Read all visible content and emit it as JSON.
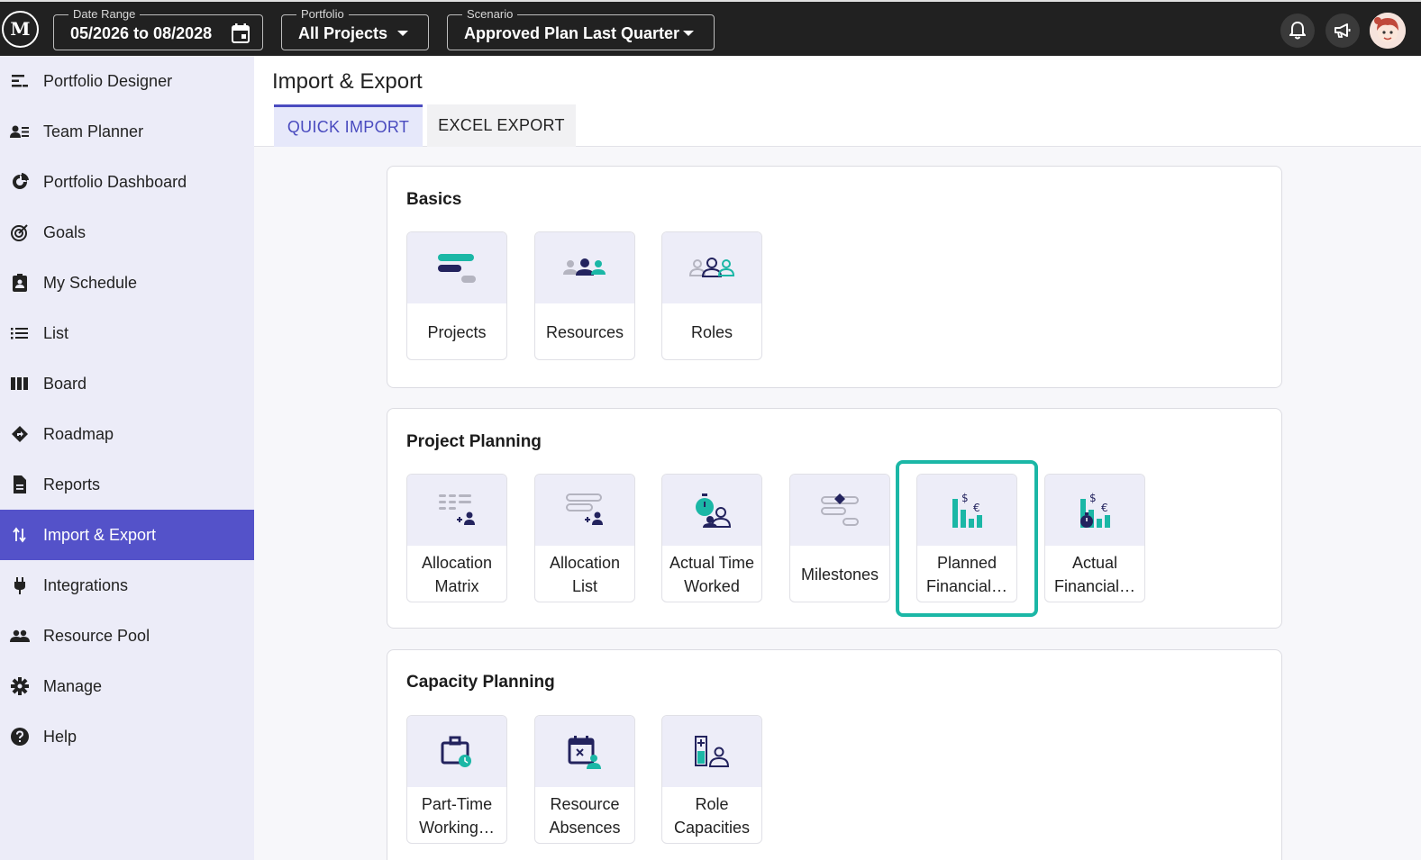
{
  "topbar": {
    "logo": "M",
    "date_range": {
      "label": "Date Range",
      "value": "05/2026 to 08/2028"
    },
    "portfolio": {
      "label": "Portfolio",
      "value": "All Projects"
    },
    "scenario": {
      "label": "Scenario",
      "value": "Approved Plan Last Quarter"
    }
  },
  "sidebar": {
    "items": [
      {
        "label": "Portfolio Designer",
        "icon": "portfolio-designer-icon"
      },
      {
        "label": "Team Planner",
        "icon": "team-planner-icon"
      },
      {
        "label": "Portfolio Dashboard",
        "icon": "dashboard-icon"
      },
      {
        "label": "Goals",
        "icon": "goals-icon"
      },
      {
        "label": "My Schedule",
        "icon": "schedule-icon"
      },
      {
        "label": "List",
        "icon": "list-icon"
      },
      {
        "label": "Board",
        "icon": "board-icon"
      },
      {
        "label": "Roadmap",
        "icon": "roadmap-icon"
      },
      {
        "label": "Reports",
        "icon": "reports-icon"
      },
      {
        "label": "Import & Export",
        "icon": "import-export-icon",
        "active": true
      },
      {
        "label": "Integrations",
        "icon": "plug-icon"
      },
      {
        "label": "Resource Pool",
        "icon": "resource-pool-icon"
      },
      {
        "label": "Manage",
        "icon": "gear-icon"
      },
      {
        "label": "Help",
        "icon": "help-icon"
      }
    ]
  },
  "page": {
    "title": "Import & Export",
    "tabs": [
      {
        "label": "QUICK IMPORT",
        "active": true
      },
      {
        "label": "EXCEL EXPORT",
        "active": false
      }
    ]
  },
  "sections": {
    "basics": {
      "title": "Basics",
      "tiles": [
        "Projects",
        "Resources",
        "Roles"
      ]
    },
    "project_planning": {
      "title": "Project Planning",
      "tiles": [
        "Allocation Matrix",
        "Allocation List",
        "Actual Time Worked",
        "Milestones",
        "Planned Financial…",
        "Actual Financial…"
      ]
    },
    "capacity_planning": {
      "title": "Capacity Planning",
      "tiles": [
        "Part-Time Working…",
        "Resource Absences",
        "Role Capacities"
      ]
    }
  },
  "colors": {
    "accent": "#5452c9",
    "teal": "#1bb7a6",
    "navy": "#23235e",
    "topbar": "#212121",
    "sidebar": "#ececf8"
  }
}
